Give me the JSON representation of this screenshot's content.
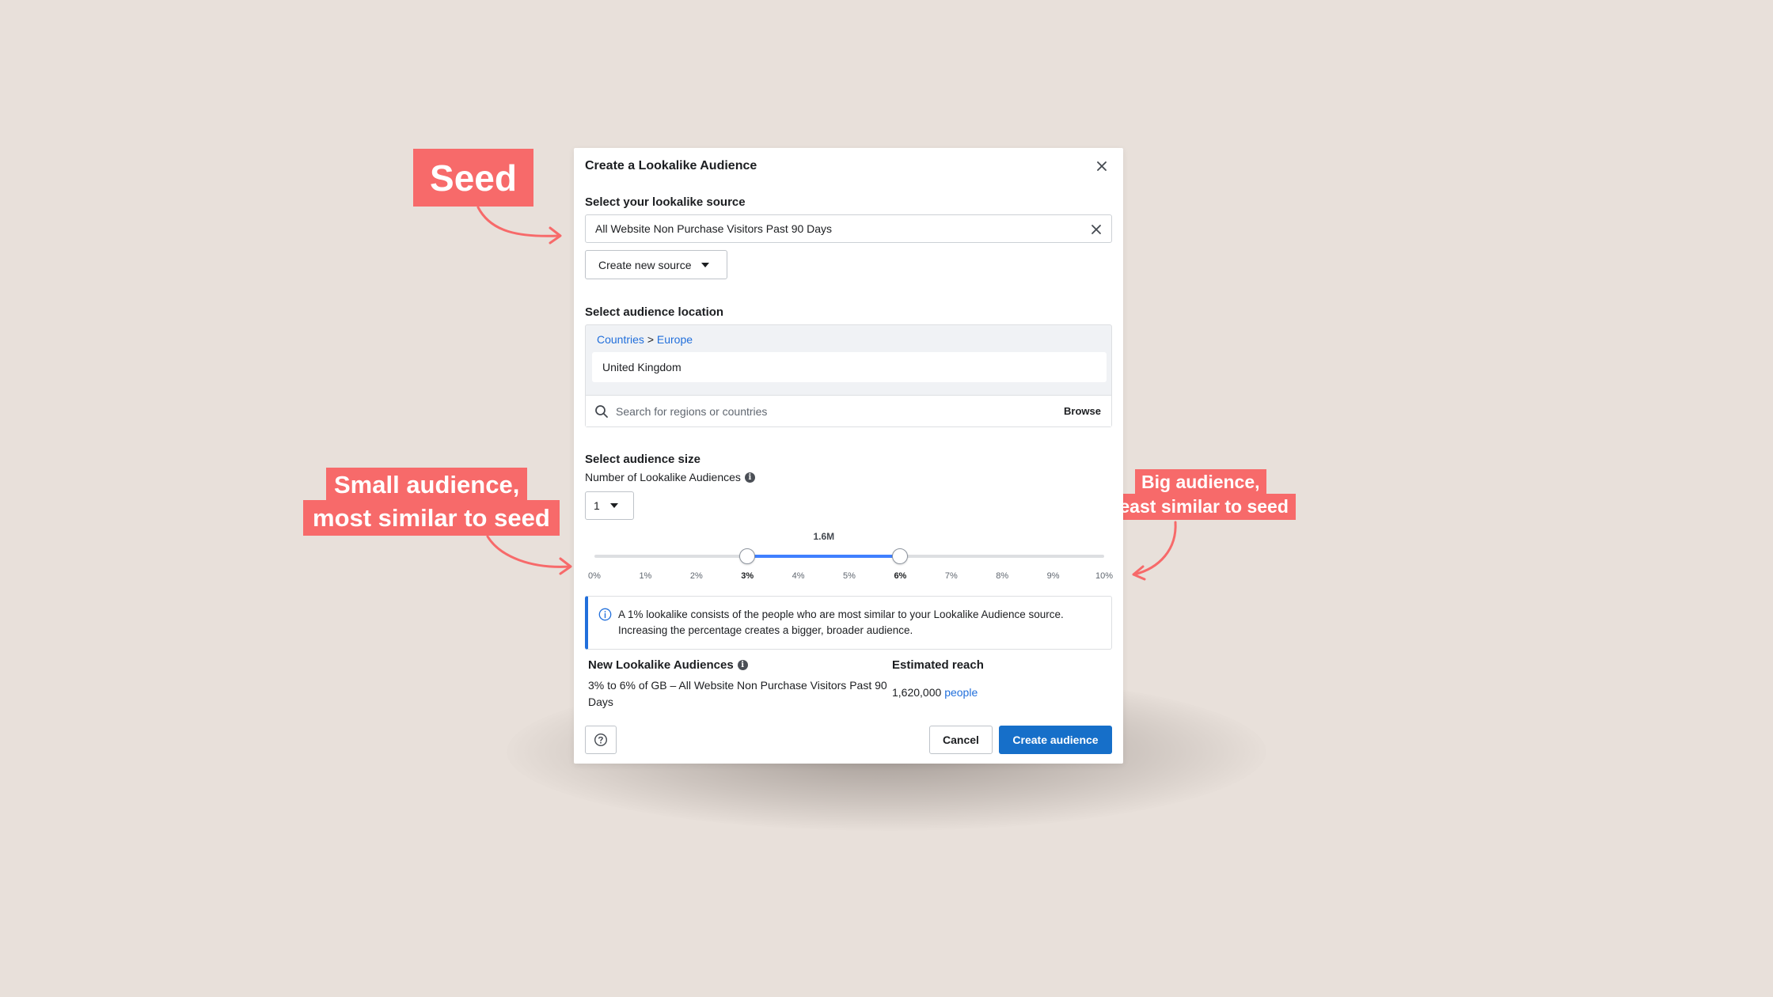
{
  "annotations": {
    "seed": "Seed",
    "small_line1": "Small audience,",
    "small_line2": "most similar to seed",
    "big_line1": "Big audience,",
    "big_line2": "least similar to seed"
  },
  "colors": {
    "annotation": "#f76a6a",
    "primary_button": "#166fc9",
    "link": "#216fdb",
    "slider_fill": "#4080ff",
    "background": "#e8e0da"
  },
  "dialog": {
    "title": "Create a Lookalike Audience",
    "close_icon": "close-icon",
    "source": {
      "label": "Select your lookalike source",
      "value": "All Website Non Purchase Visitors Past 90 Days",
      "create_new_label": "Create new source"
    },
    "location": {
      "label": "Select audience location",
      "breadcrumb_countries": "Countries",
      "breadcrumb_sep": ">",
      "breadcrumb_region": "Europe",
      "selected_country": "United Kingdom",
      "search_placeholder": "Search for regions or countries",
      "browse_label": "Browse"
    },
    "size": {
      "label": "Select audience size",
      "number_label": "Number of Lookalike Audiences",
      "number_value": "1",
      "reach_label": "1.6M",
      "range_start_percent": 3,
      "range_end_percent": 6,
      "ticks": [
        "0%",
        "1%",
        "2%",
        "3%",
        "4%",
        "5%",
        "6%",
        "7%",
        "8%",
        "9%",
        "10%"
      ],
      "bold_ticks": [
        "3%",
        "6%"
      ]
    },
    "info_text": "A 1% lookalike consists of the people who are most similar to your Lookalike Audience source. Increasing the percentage creates a bigger, broader audience.",
    "summary": {
      "new_label": "New Lookalike Audiences",
      "new_desc": "3% to 6% of GB – All Website Non Purchase Visitors Past 90 Days",
      "reach_label": "Estimated reach",
      "reach_number": "1,620,000",
      "reach_unit": "people"
    },
    "footer": {
      "cancel_label": "Cancel",
      "create_label": "Create audience"
    }
  }
}
